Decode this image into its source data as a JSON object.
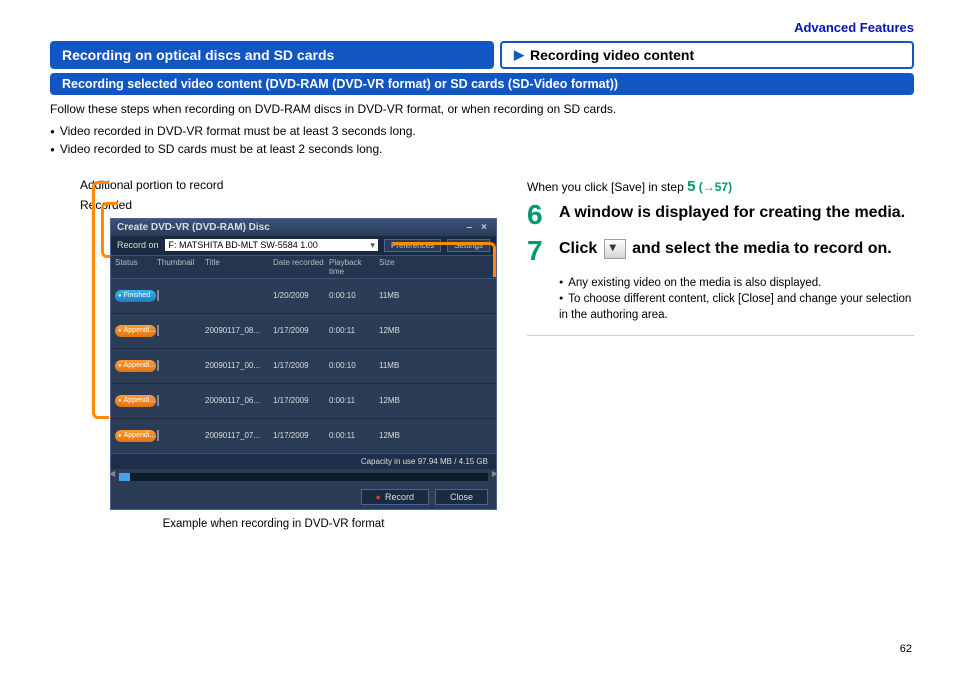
{
  "section_link": "Advanced Features",
  "hdr_left": "Recording on optical discs and SD cards",
  "hdr_right": "Recording video content",
  "subheader": "Recording selected video content (DVD-RAM (DVD-VR format) or SD cards (SD-Video format))",
  "intro": "Follow these steps when recording on DVD-RAM discs in DVD-VR format, or when recording on SD cards.",
  "pre_bullets": [
    "Video recorded in DVD-VR format must be at least 3 seconds long.",
    "Video recorded to SD cards must be at least 2 seconds long."
  ],
  "legend": {
    "a": "Additional portion to record",
    "b": "Recorded"
  },
  "dialog": {
    "title": "Create DVD-VR (DVD-RAM) Disc",
    "record_on_label": "Record on",
    "drive": "F: MATSHITA BD-MLT SW-5584 1.00",
    "opt1": "Preferences",
    "opt2": "Settings",
    "cols": {
      "status": "Status",
      "thumb": "Thumbnail",
      "title": "Title",
      "date": "Date recorded",
      "play": "Playback time",
      "size": "Size"
    },
    "rows": [
      {
        "status": "Finished",
        "title": "",
        "date": "1/20/2009",
        "play": "0:00:10",
        "size": "11MB"
      },
      {
        "status": "Appendi...",
        "title": "20090117_08...",
        "date": "1/17/2009",
        "play": "0:00:11",
        "size": "12MB"
      },
      {
        "status": "Appendi...",
        "title": "20090117_00...",
        "date": "1/17/2009",
        "play": "0:00:10",
        "size": "11MB"
      },
      {
        "status": "Appendi...",
        "title": "20090117_06...",
        "date": "1/17/2009",
        "play": "0:00:11",
        "size": "12MB"
      },
      {
        "status": "Appendi...",
        "title": "20090117_07...",
        "date": "1/17/2009",
        "play": "0:00:11",
        "size": "12MB"
      }
    ],
    "capacity": "Capacity in use  97.94 MB / 4.15 GB",
    "btn_record": "Record",
    "btn_close": "Close"
  },
  "caption": "Example when recording in DVD-VR format",
  "step_ref": {
    "pre": "When you click [Save] in step ",
    "num": "5",
    "link": "(→57)"
  },
  "step6": {
    "n": "6",
    "t": "A window is displayed for creating the media."
  },
  "step7": {
    "n": "7",
    "t1": "Click ",
    "t2": " and select the media to record on."
  },
  "sub_bullets": [
    "Any existing video on the media is also displayed.",
    "To choose different content, click [Close] and change your selection in the authoring area."
  ],
  "page": "62"
}
